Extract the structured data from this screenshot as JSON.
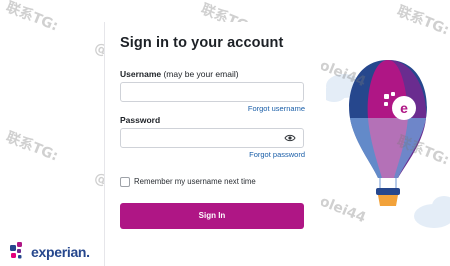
{
  "form": {
    "title": "Sign in to your account",
    "username_label": "Username",
    "username_hint": " (may be your email)",
    "username_value": "",
    "forgot_username": "Forgot username",
    "password_label": "Password",
    "password_value": "",
    "forgot_password": "Forgot password",
    "remember_label": "Remember my username next time",
    "remember_checked": false,
    "signin_button": "Sign In"
  },
  "brand": {
    "logo_text": "experian.",
    "accent": "#af1685",
    "link_color": "#1a5ea8",
    "logo_blue": "#26478d"
  },
  "watermarks": [
    "联系TG:",
    "@saolei44",
    "联系TG:",
    "@saolei44",
    "联系TG:",
    "@saolei44",
    "联系TG:",
    "@saolei44",
    "联系TG:",
    "@saolei44",
    "联系TG:",
    "@saolei44",
    "联系TG:",
    "@saolei44"
  ]
}
